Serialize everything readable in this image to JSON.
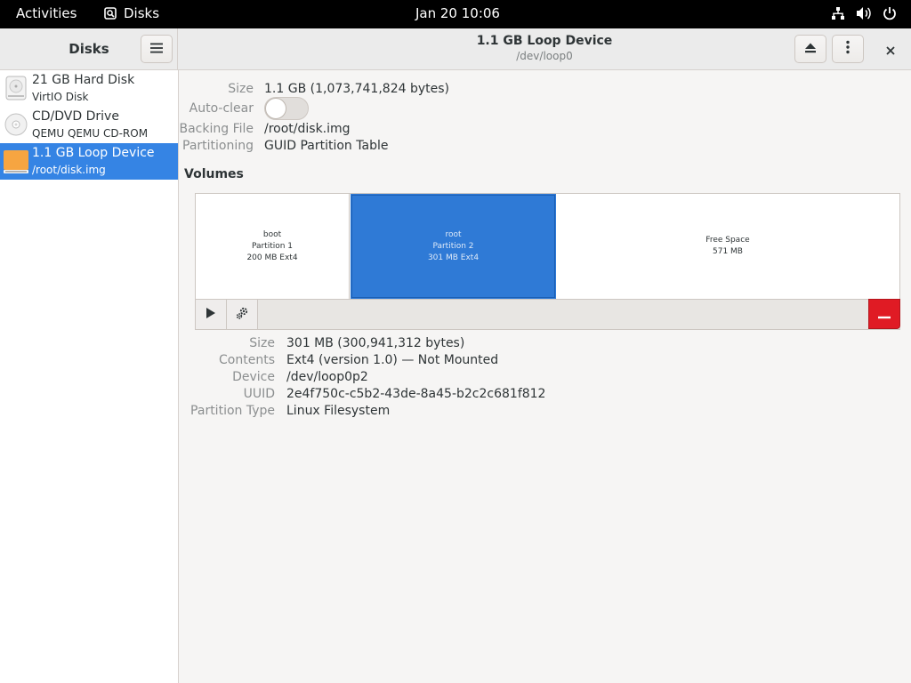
{
  "topbar": {
    "activities": "Activities",
    "app_name": "Disks",
    "clock": "Jan 20  10:06",
    "icons": [
      "network-icon",
      "volume-icon",
      "power-icon"
    ]
  },
  "sidebar": {
    "title": "Disks",
    "items": [
      {
        "name": "21 GB Hard Disk",
        "sub": "VirtIO Disk",
        "icon": "hard-disk-icon",
        "selected": false
      },
      {
        "name": "CD/DVD Drive",
        "sub": "QEMU QEMU CD-ROM",
        "icon": "optical-disc-icon",
        "selected": false
      },
      {
        "name": "1.1 GB Loop Device",
        "sub": "/root/disk.img",
        "icon": "loop-device-icon",
        "selected": true
      }
    ]
  },
  "header": {
    "title": "1.1 GB Loop Device",
    "subtitle": "/dev/loop0"
  },
  "device": {
    "size_label": "Size",
    "size_value": "1.1 GB (1,073,741,824 bytes)",
    "autoclear_label": "Auto-clear",
    "autoclear_on": false,
    "backing_label": "Backing File",
    "backing_value": "/root/disk.img",
    "partitioning_label": "Partitioning",
    "partitioning_value": "GUID Partition Table"
  },
  "volumes": {
    "title": "Volumes",
    "partitions": [
      {
        "name": "boot",
        "line2": "Partition 1",
        "line3": "200 MB Ext4",
        "selected": false
      },
      {
        "name": "root",
        "line2": "Partition 2",
        "line3": "301 MB Ext4",
        "selected": true
      },
      {
        "name": "Free Space",
        "line2": "571 MB",
        "line3": "",
        "selected": false
      }
    ]
  },
  "selected_volume": {
    "size_label": "Size",
    "size_value": "301 MB (300,941,312 bytes)",
    "contents_label": "Contents",
    "contents_value": "Ext4 (version 1.0) — Not Mounted",
    "device_label": "Device",
    "device_value": "/dev/loop0p2",
    "uuid_label": "UUID",
    "uuid_value": "2e4f750c-c5b2-43de-8a45-b2c2c681f812",
    "parttype_label": "Partition Type",
    "parttype_value": "Linux Filesystem"
  },
  "colors": {
    "accent": "#3584e4",
    "selected_partition": "#2f7ad6",
    "destructive": "#e01b24"
  }
}
